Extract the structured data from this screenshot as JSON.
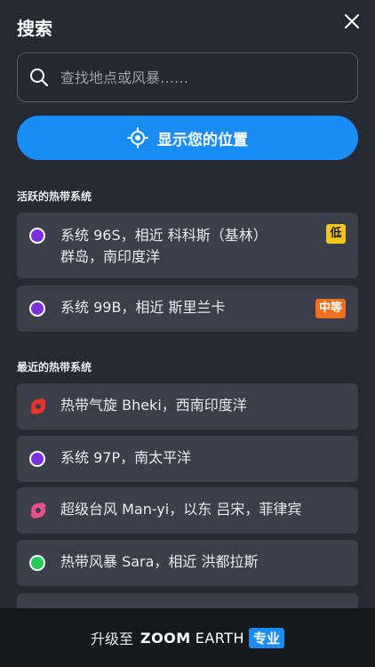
{
  "header": {
    "title": "搜索"
  },
  "search": {
    "placeholder": "查找地点或风暴……"
  },
  "location_button": {
    "label": "显示您的位置"
  },
  "active_section": {
    "title": "活跃的热带系统",
    "items": [
      {
        "line1": "系统 96S，相近 科科斯（基林）",
        "line2": "群岛，南印度洋",
        "badge": "低",
        "badge_color": "#f5c518",
        "dot_color": "#7b2fe0"
      },
      {
        "line1": "系统 99B，相近 斯里兰卡",
        "badge": "中等",
        "badge_color": "#f0701e",
        "dot_color": "#7b2fe0"
      }
    ]
  },
  "recent_section": {
    "title": "最近的热带系统",
    "items": [
      {
        "text": "热带气旋 Bheki，西南印度洋",
        "icon": "cyclone-icon",
        "color": "#e8322d"
      },
      {
        "text": "系统 97P，南太平洋",
        "icon": "dot",
        "color": "#7b2fe0"
      },
      {
        "text": "超级台风 Man-yi，以东 吕宋，菲律宾",
        "icon": "typhoon-icon",
        "color": "#e8508c"
      },
      {
        "text": "热带风暴 Sara，相近 洪都拉斯",
        "icon": "dot",
        "color": "#22cc55"
      }
    ]
  },
  "footer": {
    "prefix": "升级至",
    "brand_bold": "ZOOM",
    "brand_light": "EARTH",
    "pro": "专业"
  },
  "colors": {
    "accent": "#1a8cf5",
    "background": "#252a33",
    "card": "#3a3f49"
  }
}
